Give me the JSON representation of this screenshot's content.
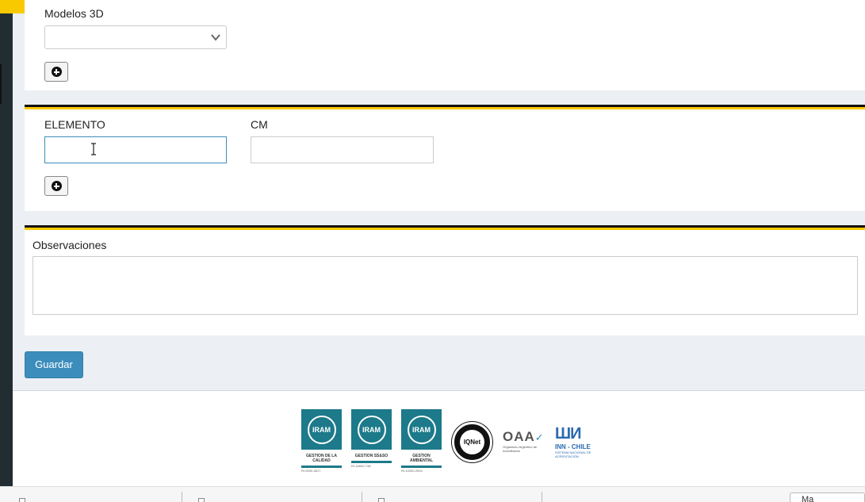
{
  "form": {
    "modelos_label": "Modelos 3D",
    "modelos_value": "",
    "elemento_label": "ELEMENTO",
    "elemento_value": "",
    "cm_label": "CM",
    "cm_value": "",
    "observaciones_label": "Observaciones",
    "observaciones_value": "",
    "save_label": "Guardar"
  },
  "footer": {
    "certs": [
      {
        "mark": "IRAM",
        "title": "GESTION DE LA CALIDAD",
        "number": "RI-9000-0617"
      },
      {
        "mark": "IRAM",
        "title": "GESTION SS&SO",
        "number": "RI-18000-748"
      },
      {
        "mark": "IRAM",
        "title": "GESTION AMBIENTAL",
        "number": "RI-14000-2004"
      }
    ],
    "iqnet_text": "IQNet",
    "oaa_text": "OAA",
    "oaa_sub": "Organismo Argentino de Acreditación",
    "inn_text": "INN - CHILE",
    "inn_sub": "SISTEMA NACIONAL DE ACREDITACIÓN"
  },
  "taskbar": {
    "more_label": "Ma"
  },
  "colors": {
    "accent_yellow": "#f9c900",
    "primary_button": "#3c8dbc",
    "sidebar": "#222d32",
    "cert_teal": "#1c7a8a"
  }
}
